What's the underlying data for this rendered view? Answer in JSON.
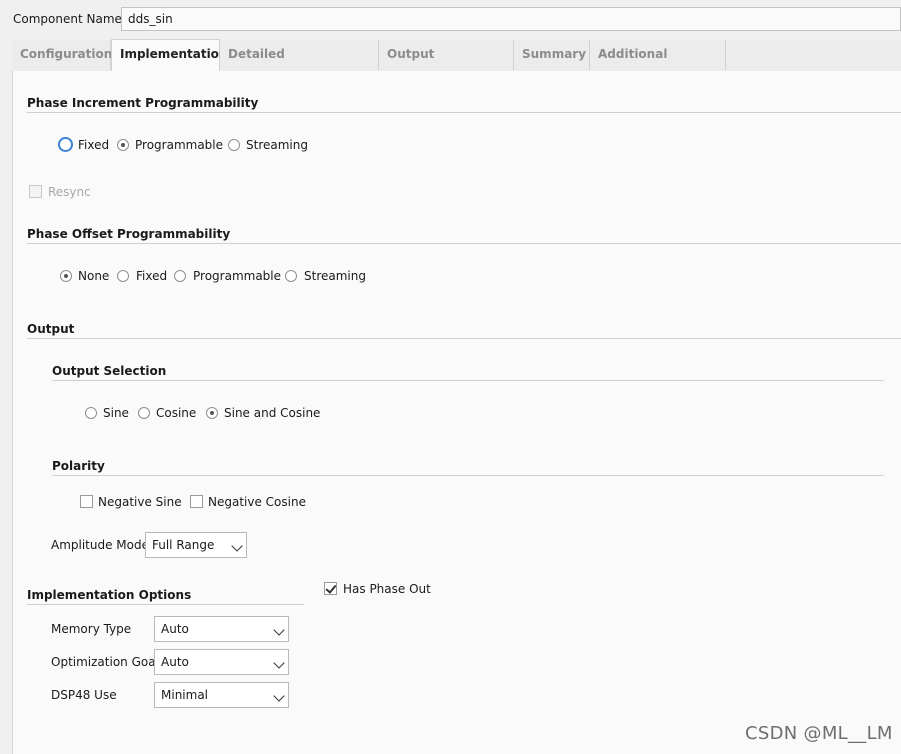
{
  "component": {
    "label": "Component Name",
    "value": "dds_sin"
  },
  "tabs": [
    {
      "label": "Configuration"
    },
    {
      "label": "Implementation"
    },
    {
      "label": "Detailed Implementation"
    },
    {
      "label": "Output Frequencies"
    },
    {
      "label": "Summary"
    },
    {
      "label": "Additional Summary"
    }
  ],
  "active_tab": "Implementation",
  "phase_increment": {
    "title": "Phase Increment Programmability",
    "options": [
      "Fixed",
      "Programmable",
      "Streaming"
    ],
    "selected": "Programmable",
    "resync_label": "Resync"
  },
  "phase_offset": {
    "title": "Phase Offset Programmability",
    "options": [
      "None",
      "Fixed",
      "Programmable",
      "Streaming"
    ],
    "selected": "None"
  },
  "output": {
    "title": "Output",
    "selection_title": "Output Selection",
    "selection_options": [
      "Sine",
      "Cosine",
      "Sine and Cosine"
    ],
    "selection_selected": "Sine and Cosine",
    "polarity_title": "Polarity",
    "negative_sine": "Negative Sine",
    "negative_cosine": "Negative Cosine",
    "amplitude_label": "Amplitude Mode",
    "amplitude_value": "Full Range"
  },
  "impl_options": {
    "title": "Implementation Options",
    "has_phase_out": "Has Phase Out",
    "memory_type_label": "Memory Type",
    "memory_type_value": "Auto",
    "opt_goal_label": "Optimization Goal",
    "opt_goal_value": "Auto",
    "dsp48_label": "DSP48 Use",
    "dsp48_value": "Minimal"
  },
  "watermark": "CSDN @ML__LM"
}
